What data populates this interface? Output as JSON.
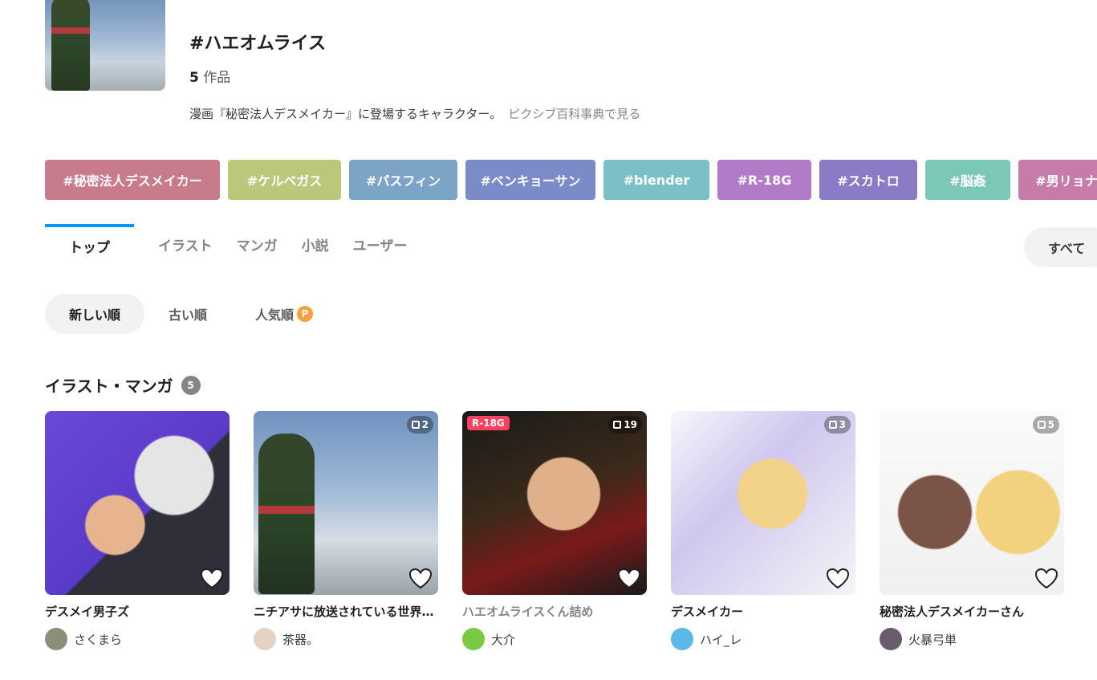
{
  "header": {
    "title": "#ハエオムライス",
    "works_count": "5",
    "works_unit": "作品",
    "description": "漫画『秘密法人デスメイカー』に登場するキャラクター。",
    "encyclopedia_link": "ピクシブ百科事典で見る"
  },
  "related_tags": [
    {
      "label": "#秘密法人デスメイカー",
      "color": "#c77b8b"
    },
    {
      "label": "#ケルベガス",
      "color": "#bcc77b"
    },
    {
      "label": "#パスフィン",
      "color": "#7ba4c7"
    },
    {
      "label": "#ベンキョーサン",
      "color": "#7b8bc7"
    },
    {
      "label": "#blender",
      "color": "#7bc0c7"
    },
    {
      "label": "#R-18G",
      "color": "#b27bc7"
    },
    {
      "label": "#スカトロ",
      "color": "#8b7bc7"
    },
    {
      "label": "#脳姦",
      "color": "#7bc7b8"
    },
    {
      "label": "#男リョナ",
      "color": "#c77ba8"
    }
  ],
  "tabs": {
    "top": "トップ",
    "illust": "イラスト",
    "manga": "マンガ",
    "novel": "小説",
    "user": "ユーザー",
    "filter": "すべて"
  },
  "sort": {
    "newest": "新しい順",
    "oldest": "古い順",
    "popular": "人気順",
    "premium_badge": "P"
  },
  "section": {
    "title": "イラスト・マンガ",
    "count": "5"
  },
  "works": [
    {
      "title": "デスメイ男子ズ",
      "user": "さくまら",
      "pages": "",
      "r18g": "",
      "avatar_color": "#8a8f7a"
    },
    {
      "title": "ニチアサに放送されている世界…",
      "user": "茶器。",
      "pages": "2",
      "r18g": "",
      "avatar_color": "#e6d2c2"
    },
    {
      "title": "ハエオムライスくん詰め",
      "user": "大介",
      "pages": "19",
      "r18g": "R-18G",
      "avatar_color": "#7ac943"
    },
    {
      "title": "デスメイカー",
      "user": "ハイ_レ",
      "pages": "3",
      "r18g": "",
      "avatar_color": "#5ab7e8"
    },
    {
      "title": "秘密法人デスメイカーさん",
      "user": "火暴弓単",
      "pages": "5",
      "r18g": "",
      "avatar_color": "#6b5b6e"
    }
  ]
}
